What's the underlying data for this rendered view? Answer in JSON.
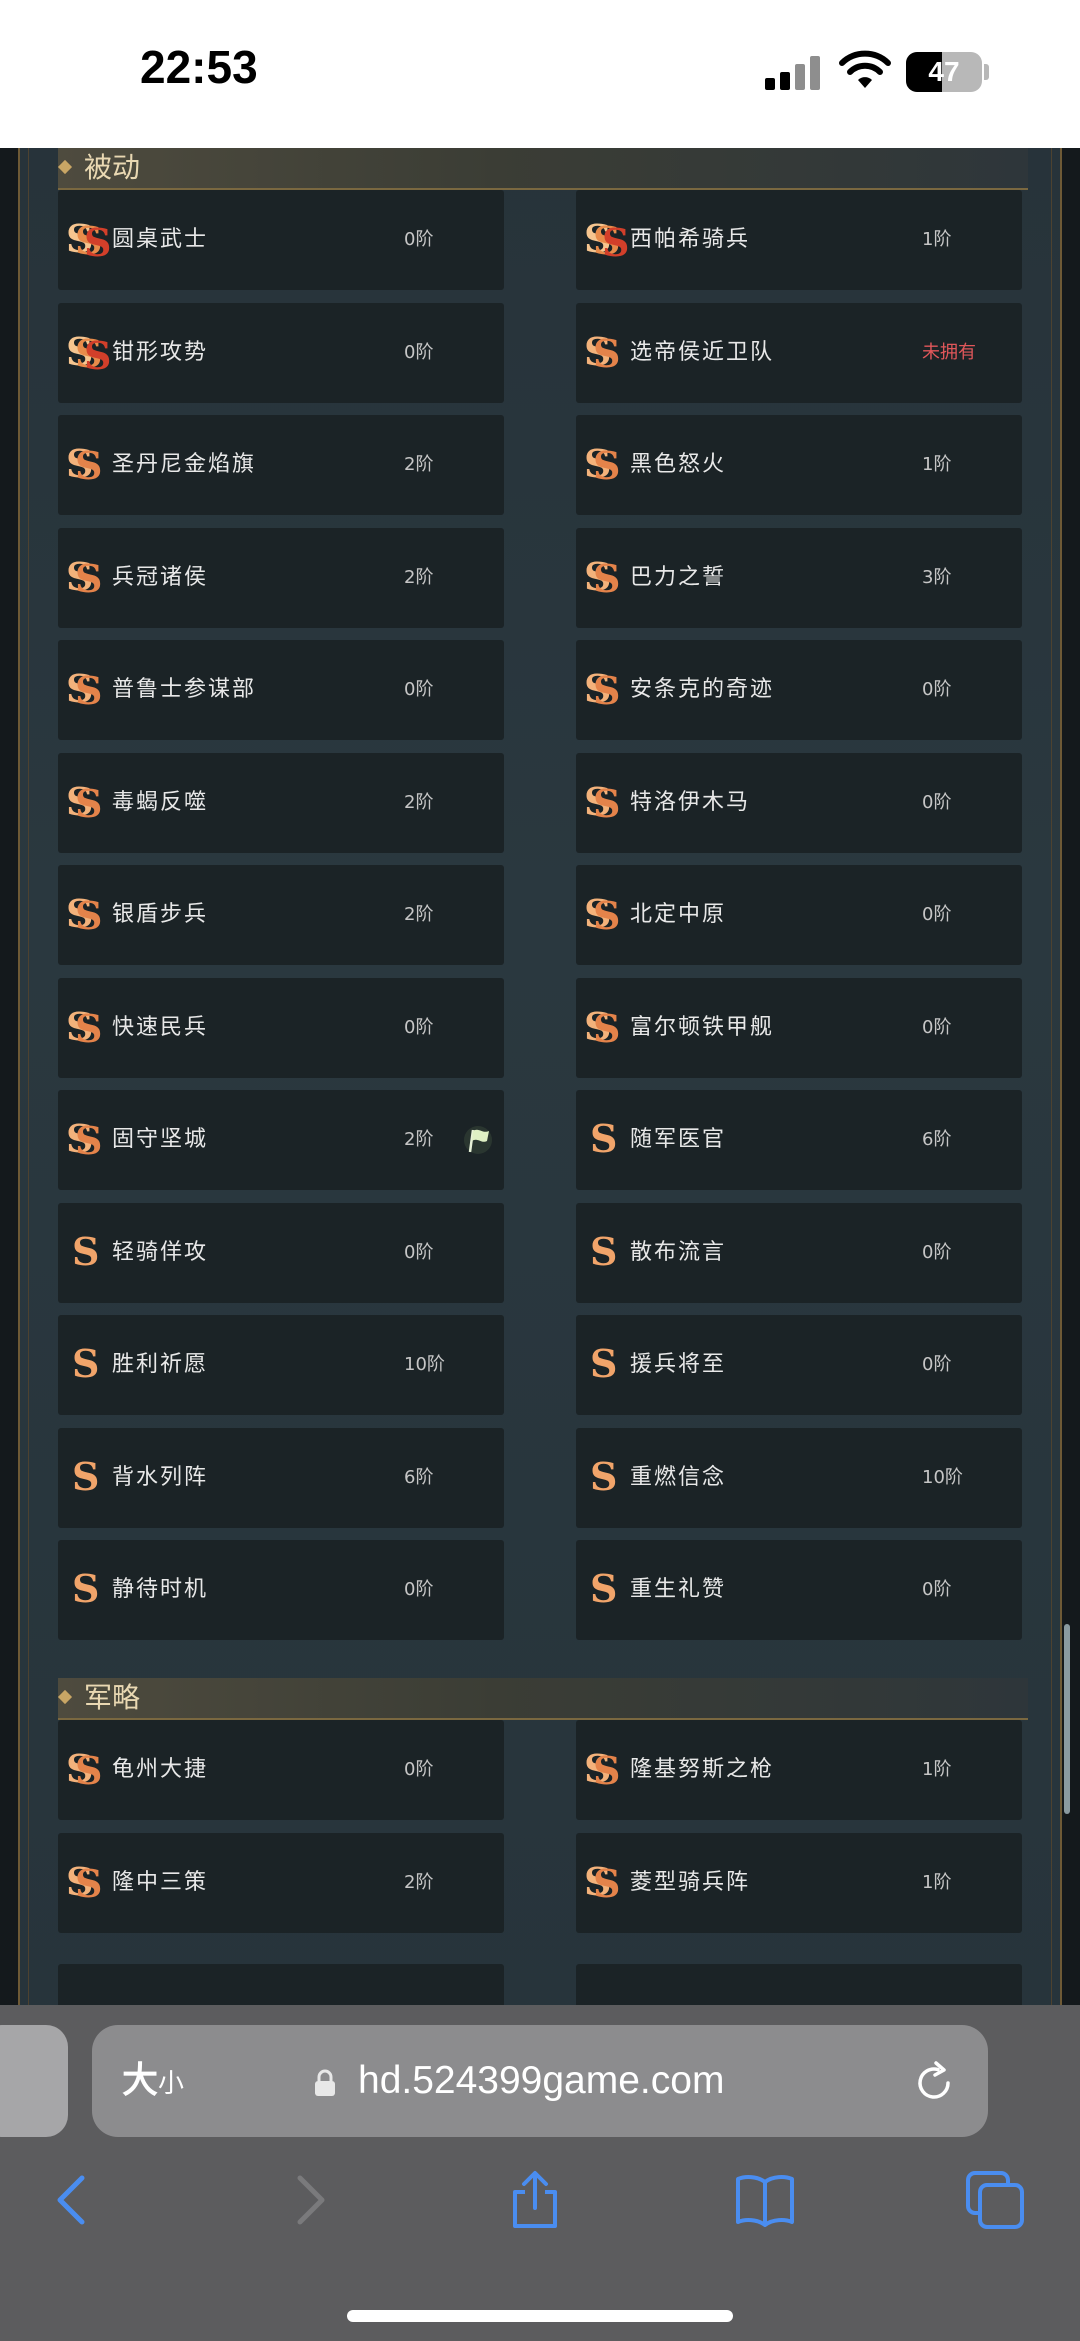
{
  "status_bar": {
    "time": "22:53",
    "battery": "47",
    "battery_fraction": 0.47
  },
  "sections": [
    {
      "title": "被动",
      "items": [
        {
          "name": "圆桌武士",
          "level": "0阶",
          "icon": "sss-icon"
        },
        {
          "name": "西帕希骑兵",
          "level": "1阶",
          "icon": "sss-icon"
        },
        {
          "name": "钳形攻势",
          "level": "0阶",
          "icon": "sss-icon"
        },
        {
          "name": "选帝侯近卫队",
          "level": "未拥有",
          "icon": "ss-icon",
          "missing": true
        },
        {
          "name": "圣丹尼金焰旗",
          "level": "2阶",
          "icon": "ss-icon"
        },
        {
          "name": "黑色怒火",
          "level": "1阶",
          "icon": "ss-icon"
        },
        {
          "name": "兵冠诸侯",
          "level": "2阶",
          "icon": "ss-icon"
        },
        {
          "name": "巴力之誓",
          "level": "3阶",
          "icon": "ss-icon"
        },
        {
          "name": "普鲁士参谋部",
          "level": "0阶",
          "icon": "ss-icon"
        },
        {
          "name": "安条克的奇迹",
          "level": "0阶",
          "icon": "ss-icon"
        },
        {
          "name": "毒蝎反噬",
          "level": "2阶",
          "icon": "ss-icon"
        },
        {
          "name": "特洛伊木马",
          "level": "0阶",
          "icon": "ss-icon"
        },
        {
          "name": "银盾步兵",
          "level": "2阶",
          "icon": "ss-icon"
        },
        {
          "name": "北定中原",
          "level": "0阶",
          "icon": "ss-icon"
        },
        {
          "name": "快速民兵",
          "level": "0阶",
          "icon": "ss-icon"
        },
        {
          "name": "富尔顿铁甲舰",
          "level": "0阶",
          "icon": "ss-icon"
        },
        {
          "name": "固守坚城",
          "level": "2阶",
          "icon": "ss-icon",
          "flag": true
        },
        {
          "name": "随军医官",
          "level": "6阶",
          "icon": "s-icon"
        },
        {
          "name": "轻骑佯攻",
          "level": "0阶",
          "icon": "s-icon"
        },
        {
          "name": "散布流言",
          "level": "0阶",
          "icon": "s-icon"
        },
        {
          "name": "胜利祈愿",
          "level": "10阶",
          "icon": "s-icon"
        },
        {
          "name": "援兵将至",
          "level": "0阶",
          "icon": "s-icon"
        },
        {
          "name": "背水列阵",
          "level": "6阶",
          "icon": "s-icon"
        },
        {
          "name": "重燃信念",
          "level": "10阶",
          "icon": "s-icon"
        },
        {
          "name": "静待时机",
          "level": "0阶",
          "icon": "s-icon"
        },
        {
          "name": "重生礼赞",
          "level": "0阶",
          "icon": "s-icon"
        }
      ]
    },
    {
      "title": "军略",
      "items": [
        {
          "name": "龟州大捷",
          "level": "0阶",
          "icon": "ss-icon"
        },
        {
          "name": "隆基努斯之枪",
          "level": "1阶",
          "icon": "ss-icon"
        },
        {
          "name": "隆中三策",
          "level": "2阶",
          "icon": "ss-icon"
        },
        {
          "name": "菱型骑兵阵",
          "level": "1阶",
          "icon": "ss-icon"
        }
      ]
    }
  ],
  "browser": {
    "text_size_label": "大",
    "text_size_small": "小",
    "url": "hd.524399game.com"
  },
  "colors": {
    "accent": "#4a8df0",
    "missing": "#e0575a",
    "card": "#1b2326",
    "panel": "#27333a"
  }
}
